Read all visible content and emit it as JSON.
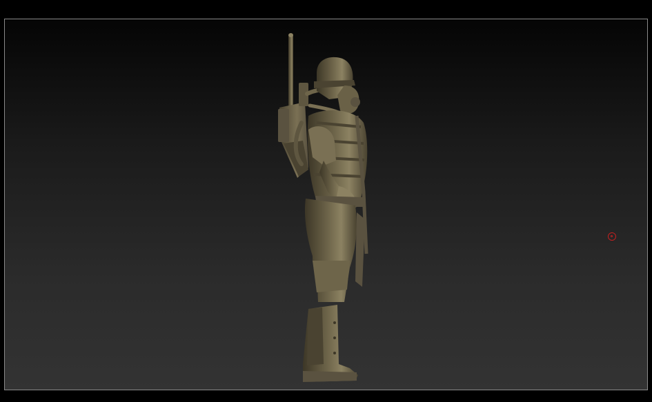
{
  "app": {
    "background_color": "#000000"
  },
  "viewport": {
    "frame_color": "#8a8a8a",
    "gradient_top": "#050505",
    "gradient_bottom": "#333333"
  },
  "model": {
    "icon": "soldier-sculpt",
    "material_color": "#6e654a",
    "highlight_color": "#8c8262",
    "shadow_color": "#3d3727"
  },
  "cursor": {
    "icon": "brush-cursor-icon",
    "color": "#c42020"
  }
}
